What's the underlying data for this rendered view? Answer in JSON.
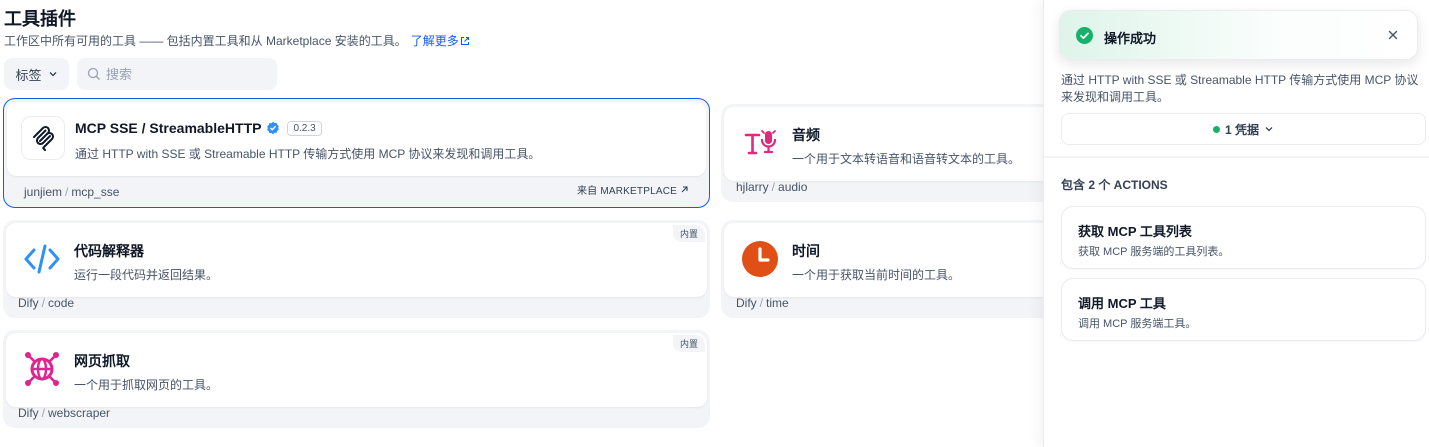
{
  "header": {
    "title": "工具插件",
    "description": "工作区中所有可用的工具 —— 包括内置工具和从 Marketplace 安装的工具。",
    "learn_more": "了解更多"
  },
  "filters": {
    "tag_label": "标签",
    "search_placeholder": "搜索"
  },
  "tools": [
    {
      "name": "MCP SSE / StreamableHTTP",
      "version": "0.2.3",
      "verified": true,
      "description": "通过 HTTP with SSE 或 Streamable HTTP 传输方式使用 MCP 协议来发现和调用工具。",
      "org": "junjiem",
      "pkg": "mcp_sse",
      "source": "来自 MARKETPLACE",
      "icon": "mcp-icon"
    },
    {
      "name": "音频",
      "description": "一个用于文本转语音和语音转文本的工具。",
      "org": "hjlarry",
      "pkg": "audio",
      "icon": "text-to-speech-icon",
      "icon_color": "#e0287f"
    },
    {
      "name": "代码解释器",
      "description": "运行一段代码并返回结果。",
      "org": "Dify",
      "pkg": "code",
      "badge": "内置",
      "icon": "code-icon",
      "icon_color": "#2e90fa"
    },
    {
      "name": "时间",
      "description": "一个用于获取当前时间的工具。",
      "org": "Dify",
      "pkg": "time",
      "icon": "clock-icon",
      "icon_color": "#e04f16"
    },
    {
      "name": "网页抓取",
      "description": "一个用于抓取网页的工具。",
      "org": "Dify",
      "pkg": "webscraper",
      "badge": "内置",
      "icon": "globe-icon",
      "icon_color": "#dd2590"
    }
  ],
  "drawer": {
    "description": "通过 HTTP with SSE 或 Streamable HTTP 传输方式使用 MCP 协议来发现和调用工具。",
    "credentials_label": "1 凭据",
    "actions_heading": "包含 2 个 ACTIONS",
    "actions": [
      {
        "title": "获取 MCP 工具列表",
        "description": "获取 MCP 服务端的工具列表。"
      },
      {
        "title": "调用 MCP 工具",
        "description": "调用 MCP 服务端工具。"
      }
    ]
  },
  "toast": {
    "message": "操作成功",
    "status": "success",
    "color": "#17b26a"
  }
}
